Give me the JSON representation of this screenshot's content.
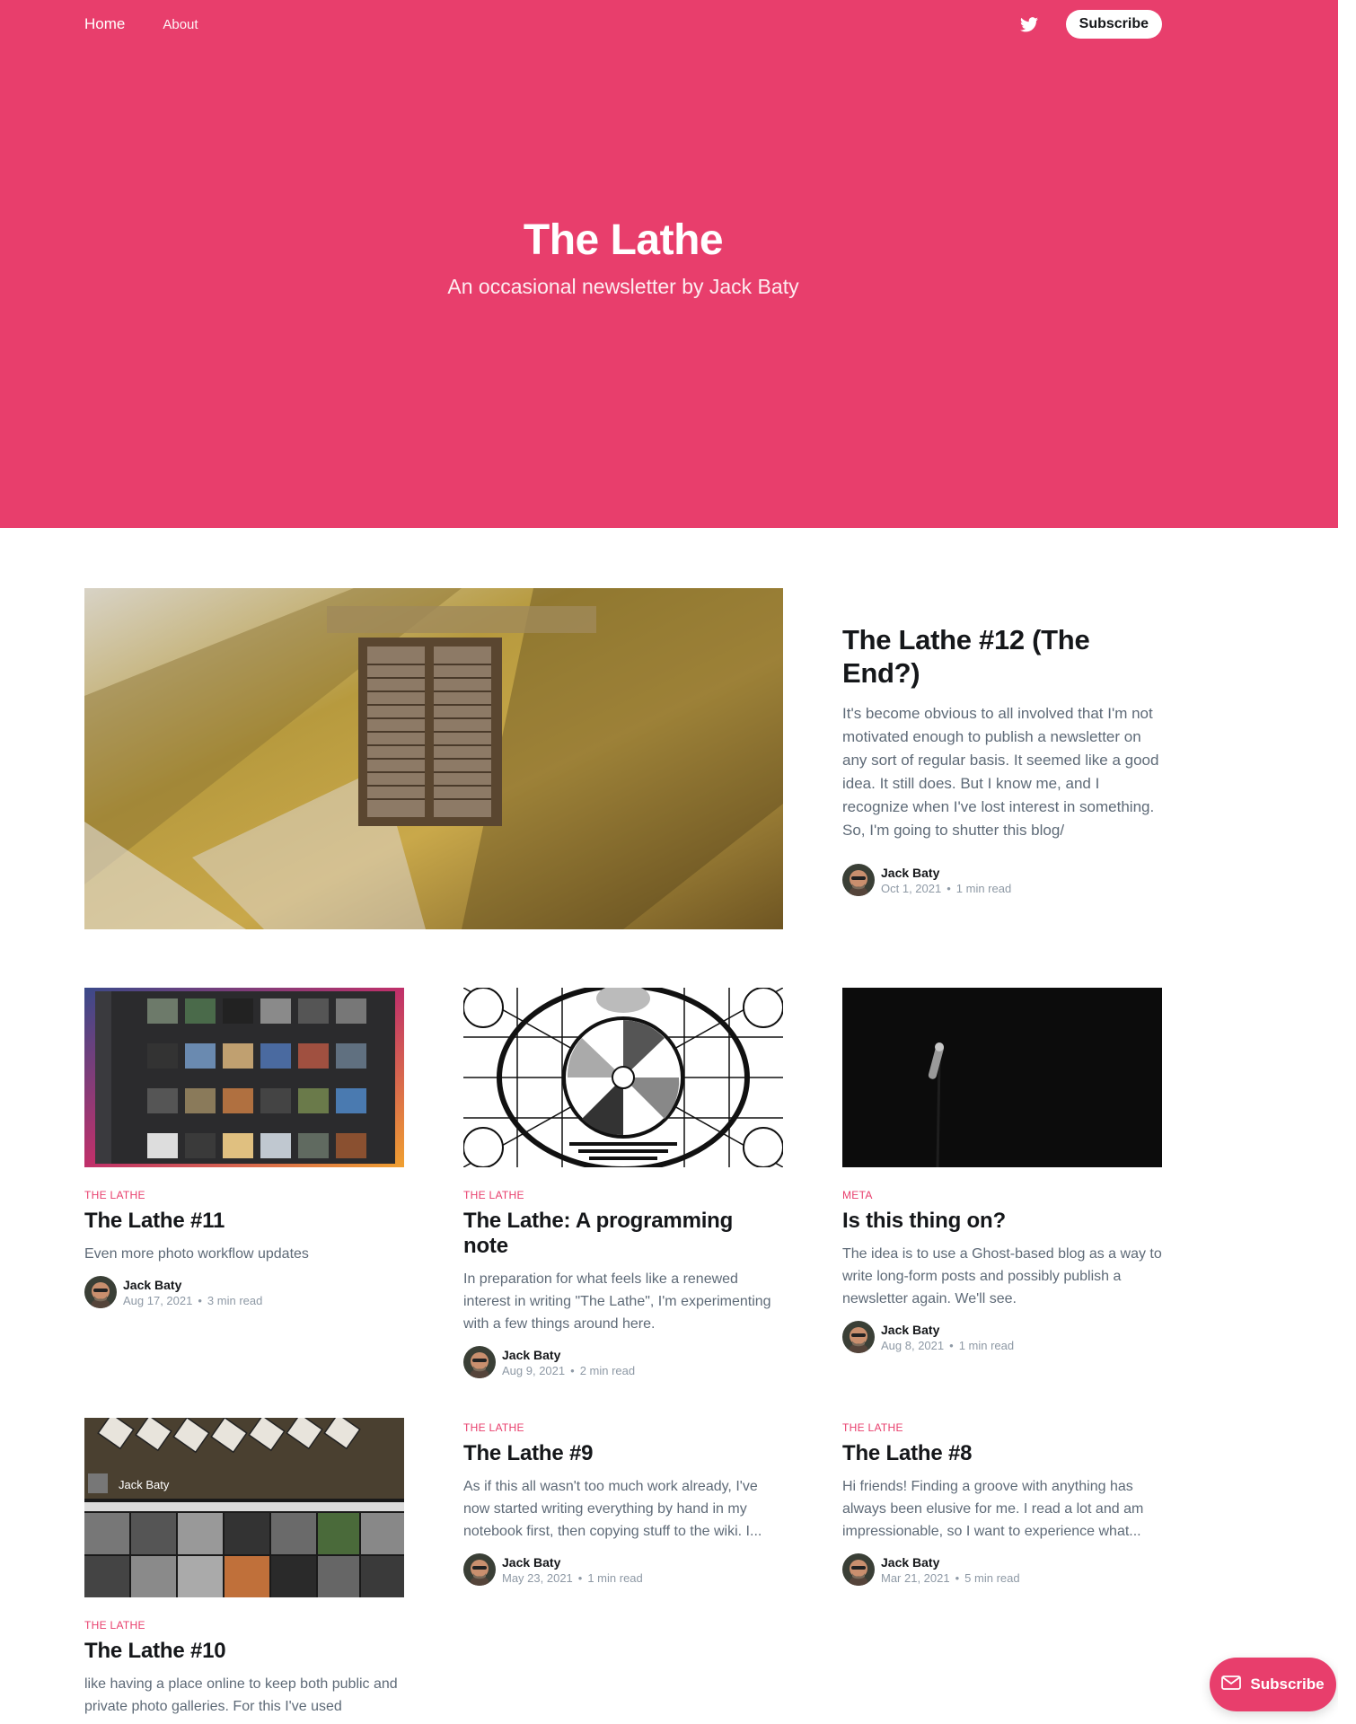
{
  "nav": {
    "home": "Home",
    "about": "About",
    "twitter_icon": "twitter-icon",
    "subscribe": "Subscribe"
  },
  "hero": {
    "title": "The Lathe",
    "subtitle": "An occasional newsletter by Jack Baty"
  },
  "featured": {
    "title": "The Lathe #12 (The End?)",
    "excerpt": "It's become obvious to all involved that I'm not motivated enough to publish a newsletter on any sort of regular basis. It seemed like a good idea. It still does. But I know me, and I recognize when I've lost interest in something. So, I'm going to shutter this blog/",
    "author": "Jack Baty",
    "date": "Oct 1, 2021",
    "read_time": "1 min read"
  },
  "posts": [
    {
      "tag": "THE LATHE",
      "title": "The Lathe #11",
      "excerpt": "Even more photo workflow updates",
      "author": "Jack Baty",
      "date": "Aug 17, 2021",
      "read_time": "3 min read"
    },
    {
      "tag": "THE LATHE",
      "title": "The Lathe: A programming note",
      "excerpt": "In preparation for what feels like a renewed interest in writing \"The Lathe\", I'm experimenting with a few things around here.",
      "author": "Jack Baty",
      "date": "Aug 9, 2021",
      "read_time": "2 min read"
    },
    {
      "tag": "META",
      "title": "Is this thing on?",
      "excerpt": "The idea is to use a Ghost-based blog as a way to write long-form posts and possibly publish a newsletter again. We'll see.",
      "author": "Jack Baty",
      "date": "Aug 8, 2021",
      "read_time": "1 min read"
    },
    {
      "tag": "THE LATHE",
      "title": "The Lathe #10",
      "excerpt": "like having a place online to keep both public and private photo galleries. For this I've used",
      "author": "Jack Baty",
      "date": "",
      "read_time": "",
      "image_overlay": "Jack Baty"
    },
    {
      "tag": "THE LATHE",
      "title": "The Lathe #9",
      "excerpt": "As if this all wasn't too much work already, I've now started writing everything by hand in my notebook first, then copying stuff to the wiki. I...",
      "author": "Jack Baty",
      "date": "May 23, 2021",
      "read_time": "1 min read"
    },
    {
      "tag": "THE LATHE",
      "title": "The Lathe #8",
      "excerpt": "Hi friends! Finding a groove with anything has always been elusive for me. I read a lot and am impressionable, so I want to experience what...",
      "author": "Jack Baty",
      "date": "Mar 21, 2021",
      "read_time": "5 min read"
    }
  ],
  "floating_subscribe": {
    "label": "Subscribe",
    "icon": "mail-icon"
  },
  "colors": {
    "accent": "#e83e6c",
    "text": "#15171a",
    "muted": "#5e6a77"
  }
}
